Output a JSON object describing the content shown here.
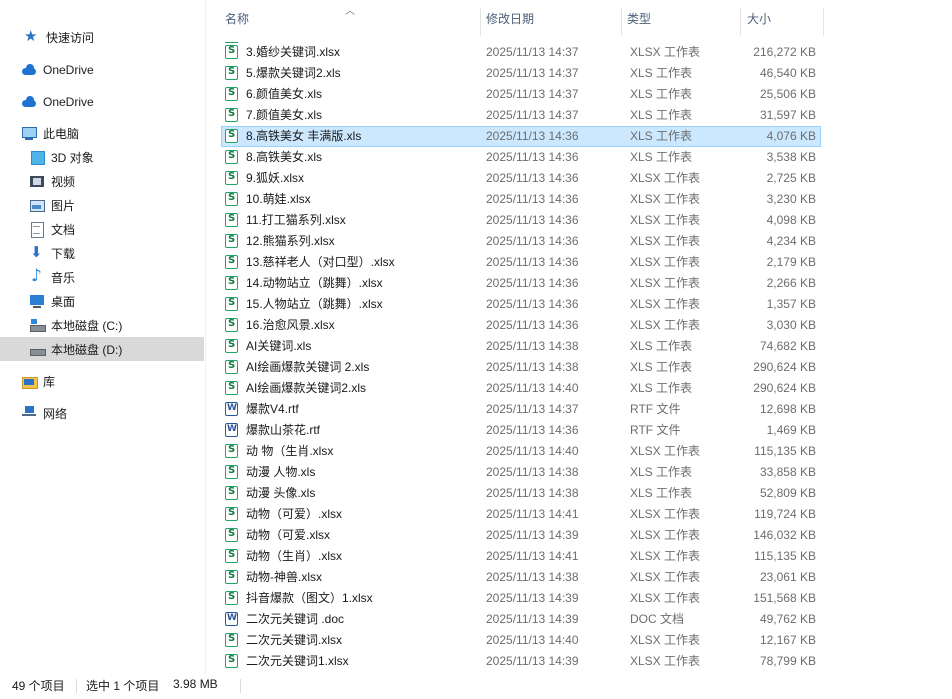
{
  "nav": {
    "items": [
      {
        "label": "快速访问",
        "icon": "star-icon"
      },
      {
        "label": "OneDrive",
        "icon": "cloud-icon"
      },
      {
        "label": "OneDrive",
        "icon": "cloud-icon"
      },
      {
        "label": "此电脑",
        "icon": "computer-icon"
      },
      {
        "label": "3D 对象",
        "icon": "cube-icon"
      },
      {
        "label": "视频",
        "icon": "video-icon"
      },
      {
        "label": "图片",
        "icon": "picture-icon"
      },
      {
        "label": "文档",
        "icon": "document-icon"
      },
      {
        "label": "下载",
        "icon": "download-icon"
      },
      {
        "label": "音乐",
        "icon": "music-icon"
      },
      {
        "label": "桌面",
        "icon": "desktop-icon"
      },
      {
        "label": "本地磁盘 (C:)",
        "icon": "drive-c-icon"
      },
      {
        "label": "本地磁盘 (D:)",
        "icon": "drive-d-icon",
        "selected": true
      },
      {
        "label": "库",
        "icon": "library-icon"
      },
      {
        "label": "网络",
        "icon": "network-icon"
      }
    ]
  },
  "columns": {
    "name": "名称",
    "date": "修改日期",
    "type": "类型",
    "size": "大小"
  },
  "files": [
    {
      "name": "3.婚纱关键词.xlsx",
      "date": "2025/11/13 14:37",
      "type": "XLSX 工作表",
      "size": "216,272 KB",
      "icon": "xls"
    },
    {
      "name": "5.爆款关键词2.xls",
      "date": "2025/11/13 14:37",
      "type": "XLS 工作表",
      "size": "46,540 KB",
      "icon": "xls"
    },
    {
      "name": "6.颜值美女.xls",
      "date": "2025/11/13 14:37",
      "type": "XLS 工作表",
      "size": "25,506 KB",
      "icon": "xls"
    },
    {
      "name": "7.颜值美女.xls",
      "date": "2025/11/13 14:37",
      "type": "XLS 工作表",
      "size": "31,597 KB",
      "icon": "xls"
    },
    {
      "name": "8.高铁美女 丰满版.xls",
      "date": "2025/11/13 14:36",
      "type": "XLS 工作表",
      "size": "4,076 KB",
      "icon": "xls",
      "selected": true
    },
    {
      "name": "8.高铁美女.xls",
      "date": "2025/11/13 14:36",
      "type": "XLS 工作表",
      "size": "3,538 KB",
      "icon": "xls"
    },
    {
      "name": "9.狐妖.xlsx",
      "date": "2025/11/13 14:36",
      "type": "XLSX 工作表",
      "size": "2,725 KB",
      "icon": "xls"
    },
    {
      "name": "10.萌娃.xlsx",
      "date": "2025/11/13 14:36",
      "type": "XLSX 工作表",
      "size": "3,230 KB",
      "icon": "xls"
    },
    {
      "name": "11.打工猫系列.xlsx",
      "date": "2025/11/13 14:36",
      "type": "XLSX 工作表",
      "size": "4,098 KB",
      "icon": "xls"
    },
    {
      "name": "12.熊猫系列.xlsx",
      "date": "2025/11/13 14:36",
      "type": "XLSX 工作表",
      "size": "4,234 KB",
      "icon": "xls"
    },
    {
      "name": "13.慈祥老人（对口型）.xlsx",
      "date": "2025/11/13 14:36",
      "type": "XLSX 工作表",
      "size": "2,179 KB",
      "icon": "xls"
    },
    {
      "name": "14.动物站立（跳舞）.xlsx",
      "date": "2025/11/13 14:36",
      "type": "XLSX 工作表",
      "size": "2,266 KB",
      "icon": "xls"
    },
    {
      "name": "15.人物站立（跳舞）.xlsx",
      "date": "2025/11/13 14:36",
      "type": "XLSX 工作表",
      "size": "1,357 KB",
      "icon": "xls"
    },
    {
      "name": "16.治愈风景.xlsx",
      "date": "2025/11/13 14:36",
      "type": "XLSX 工作表",
      "size": "3,030 KB",
      "icon": "xls"
    },
    {
      "name": "AI关键词.xls",
      "date": "2025/11/13 14:38",
      "type": "XLS 工作表",
      "size": "74,682 KB",
      "icon": "xls"
    },
    {
      "name": "AI绘画爆款关键词 2.xls",
      "date": "2025/11/13 14:38",
      "type": "XLS 工作表",
      "size": "290,624 KB",
      "icon": "xls"
    },
    {
      "name": "AI绘画爆款关键词2.xls",
      "date": "2025/11/13 14:40",
      "type": "XLS 工作表",
      "size": "290,624 KB",
      "icon": "xls"
    },
    {
      "name": "爆款V4.rtf",
      "date": "2025/11/13 14:37",
      "type": "RTF 文件",
      "size": "12,698 KB",
      "icon": "doc"
    },
    {
      "name": "爆款山茶花.rtf",
      "date": "2025/11/13 14:36",
      "type": "RTF 文件",
      "size": "1,469 KB",
      "icon": "doc"
    },
    {
      "name": "动 物（生肖.xlsx",
      "date": "2025/11/13 14:40",
      "type": "XLSX 工作表",
      "size": "115,135 KB",
      "icon": "xls"
    },
    {
      "name": "动漫 人物.xls",
      "date": "2025/11/13 14:38",
      "type": "XLS 工作表",
      "size": "33,858 KB",
      "icon": "xls"
    },
    {
      "name": "动漫 头像.xls",
      "date": "2025/11/13 14:38",
      "type": "XLS 工作表",
      "size": "52,809 KB",
      "icon": "xls"
    },
    {
      "name": "动物（可爱）.xlsx",
      "date": "2025/11/13 14:41",
      "type": "XLSX 工作表",
      "size": "119,724 KB",
      "icon": "xls"
    },
    {
      "name": "动物（可爱.xlsx",
      "date": "2025/11/13 14:39",
      "type": "XLSX 工作表",
      "size": "146,032 KB",
      "icon": "xls"
    },
    {
      "name": "动物（生肖）.xlsx",
      "date": "2025/11/13 14:41",
      "type": "XLSX 工作表",
      "size": "115,135 KB",
      "icon": "xls"
    },
    {
      "name": "动物-神兽.xlsx",
      "date": "2025/11/13 14:38",
      "type": "XLSX 工作表",
      "size": "23,061 KB",
      "icon": "xls"
    },
    {
      "name": "抖音爆款（图文）1.xlsx",
      "date": "2025/11/13 14:39",
      "type": "XLSX 工作表",
      "size": "151,568 KB",
      "icon": "xls"
    },
    {
      "name": "二次元关键词 .doc",
      "date": "2025/11/13 14:39",
      "type": "DOC 文档",
      "size": "49,762 KB",
      "icon": "doc"
    },
    {
      "name": "二次元关键词.xlsx",
      "date": "2025/11/13 14:40",
      "type": "XLSX 工作表",
      "size": "12,167 KB",
      "icon": "xls"
    },
    {
      "name": "二次元关键词1.xlsx",
      "date": "2025/11/13 14:39",
      "type": "XLSX 工作表",
      "size": "78,799 KB",
      "icon": "xls"
    }
  ],
  "status": {
    "count": "49 个项目",
    "selection": "选中 1 个项目",
    "size": "3.98 MB"
  }
}
